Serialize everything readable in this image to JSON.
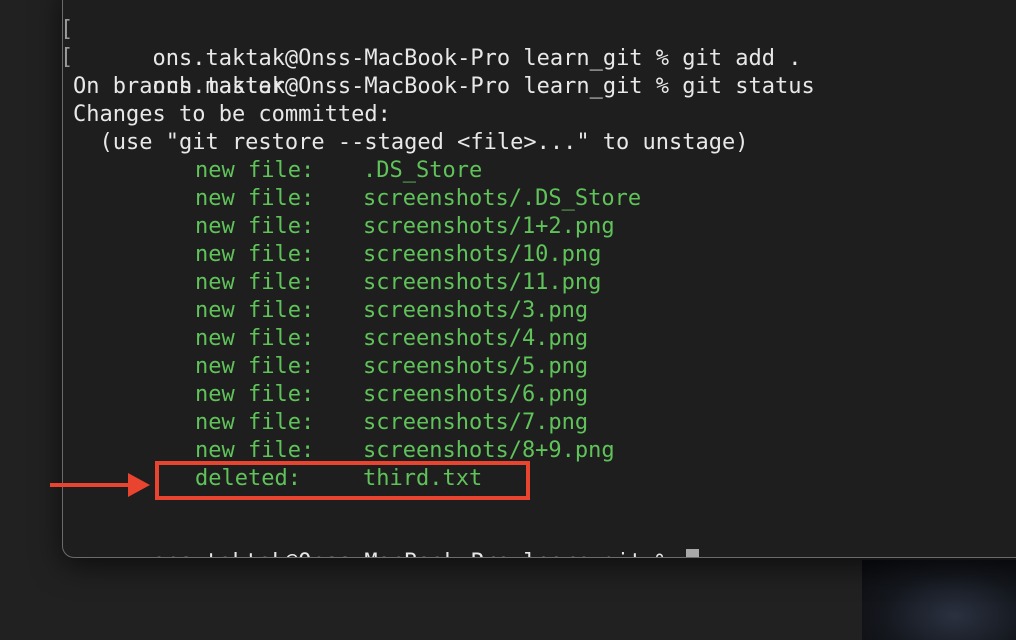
{
  "terminal": {
    "prompt": "ons.taktak@Onss-MacBook-Pro learn_git %",
    "commands": {
      "add": "git add .",
      "status": "git status"
    },
    "output": {
      "branch_line": "On branch master",
      "changes_header": "Changes to be committed:",
      "hint": "  (use \"git restore --staged <file>...\" to unstage)",
      "files": [
        {
          "status": "new file:",
          "path": ".DS_Store"
        },
        {
          "status": "new file:",
          "path": "screenshots/.DS_Store"
        },
        {
          "status": "new file:",
          "path": "screenshots/1+2.png"
        },
        {
          "status": "new file:",
          "path": "screenshots/10.png"
        },
        {
          "status": "new file:",
          "path": "screenshots/11.png"
        },
        {
          "status": "new file:",
          "path": "screenshots/3.png"
        },
        {
          "status": "new file:",
          "path": "screenshots/4.png"
        },
        {
          "status": "new file:",
          "path": "screenshots/5.png"
        },
        {
          "status": "new file:",
          "path": "screenshots/6.png"
        },
        {
          "status": "new file:",
          "path": "screenshots/7.png"
        },
        {
          "status": "new file:",
          "path": "screenshots/8+9.png"
        },
        {
          "status": "deleted:",
          "path": "third.txt"
        }
      ]
    }
  },
  "colors": {
    "background": "#1e1e1e",
    "text": "#e8e8e8",
    "staged_green": "#5fc35a",
    "annotation_red": "#e8442f",
    "cursor": "#a8a8a8"
  }
}
